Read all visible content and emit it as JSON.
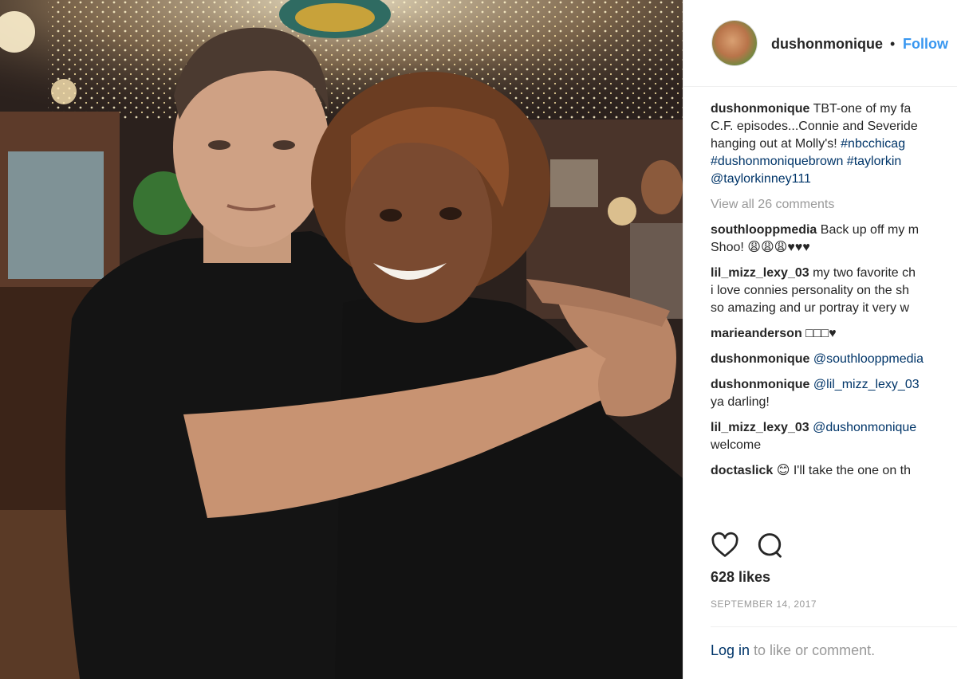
{
  "header": {
    "username": "dushonmonique",
    "separator": "•",
    "follow_label": "Follow"
  },
  "caption": {
    "username": "dushonmonique",
    "line1": "TBT-one of my fa",
    "line2": "C.F. episodes...Connie and Severide",
    "line3_text": "hanging out at Molly's! ",
    "line3_tag": "#nbcchicag",
    "line4_tags": "#dushonmoniquebrown #taylorkin",
    "line5_mention": "@taylorkinney111"
  },
  "view_all_label": "View all 26 comments",
  "comments": [
    {
      "username": "southlooppmedia",
      "lines": [
        "Back up off my m",
        "Shoo! 😩😩😩♥♥♥"
      ]
    },
    {
      "username": "lil_mizz_lexy_03",
      "lines": [
        "my two favorite ch",
        "i love connies personality on the sh",
        "so amazing and ur portray it very w"
      ]
    },
    {
      "username": "marieanderson",
      "lines": [
        "□□□♥"
      ]
    },
    {
      "username": "dushonmonique",
      "lines": [
        "@southlooppmedia"
      ]
    },
    {
      "username": "dushonmonique",
      "lines": [
        "@lil_mizz_lexy_03",
        "ya darling!"
      ]
    },
    {
      "username": "lil_mizz_lexy_03",
      "lines": [
        "@dushonmonique",
        "welcome"
      ]
    },
    {
      "username": "doctaslick",
      "lines": [
        "😊 I'll take the one on th"
      ]
    }
  ],
  "actions": {
    "like_icon": "heart-icon",
    "comment_icon": "comment-icon"
  },
  "likes_label": "628 likes",
  "date_label": "SEPTEMBER 14, 2017",
  "login": {
    "link": "Log in",
    "rest": " to like or comment."
  }
}
